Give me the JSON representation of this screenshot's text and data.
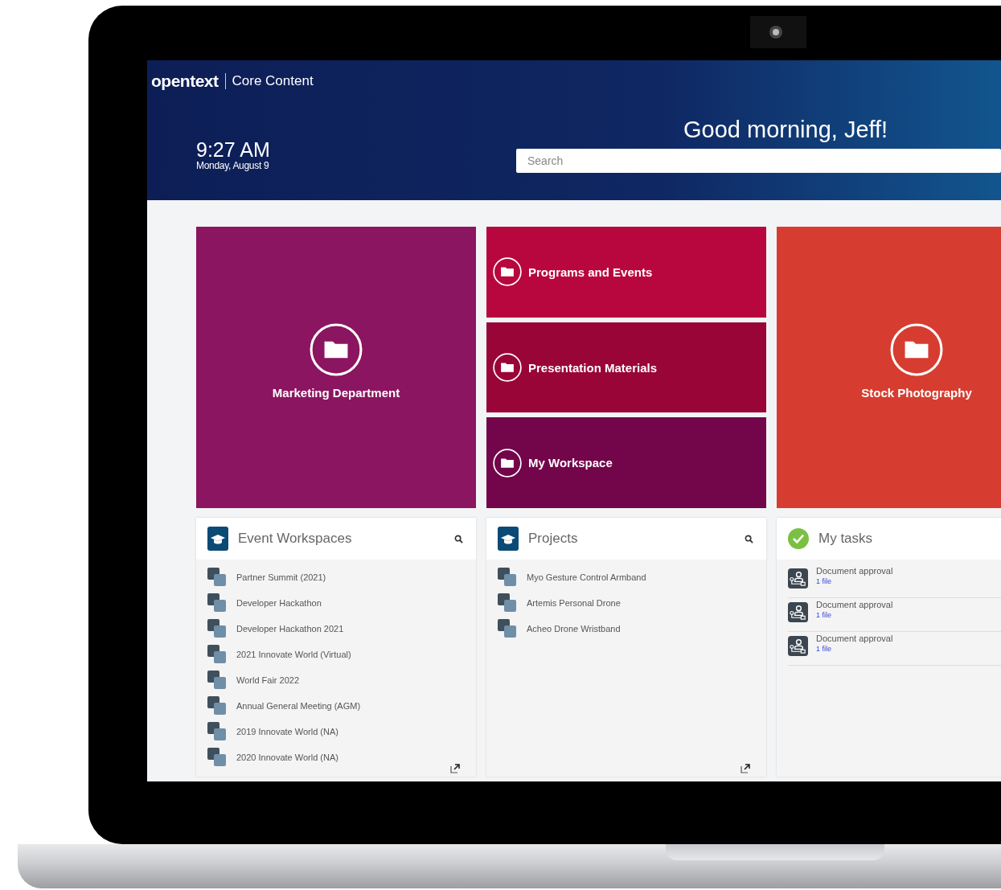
{
  "header": {
    "logo": "opentext",
    "product": "Core Content",
    "time": "9:27 AM",
    "date": "Monday, August 9",
    "greeting": "Good morning, Jeff!",
    "search": {
      "placeholder": "Search"
    }
  },
  "tile_columns": [
    [
      {
        "title": "Marketing Department",
        "color": "#8b1560"
      }
    ],
    [
      {
        "title": "Programs and Events",
        "color": "#b8073e"
      },
      {
        "title": "Presentation Materials",
        "color": "#9a0537"
      },
      {
        "title": "My Workspace",
        "color": "#73054a"
      }
    ],
    [
      {
        "title": "Stock Photography",
        "color": "#d63d30"
      }
    ]
  ],
  "panels": [
    {
      "kind": "workspaces",
      "title": "Event Workspaces",
      "search": true,
      "open_link": true,
      "items": [
        {
          "title": "Partner Summit (2021)"
        },
        {
          "title": "Developer Hackathon"
        },
        {
          "title": "Developer Hackathon 2021"
        },
        {
          "title": "2021 Innovate World (Virtual)"
        },
        {
          "title": "World Fair 2022"
        },
        {
          "title": "Annual General Meeting (AGM)"
        },
        {
          "title": "2019 Innovate World (NA)"
        },
        {
          "title": "2020 Innovate World (NA)"
        }
      ]
    },
    {
      "kind": "workspaces",
      "title": "Projects",
      "search": true,
      "open_link": true,
      "items": [
        {
          "title": "Myo Gesture Control Armband"
        },
        {
          "title": "Artemis Personal Drone"
        },
        {
          "title": "Acheo Drone Wristband"
        }
      ]
    },
    {
      "kind": "tasks",
      "title": "My tasks",
      "search": false,
      "open_link": false,
      "items": [
        {
          "title": "Document approval",
          "detail": "1 file"
        },
        {
          "title": "Document approval",
          "detail": "1 file"
        },
        {
          "title": "Document approval",
          "detail": "1 file"
        }
      ]
    }
  ]
}
